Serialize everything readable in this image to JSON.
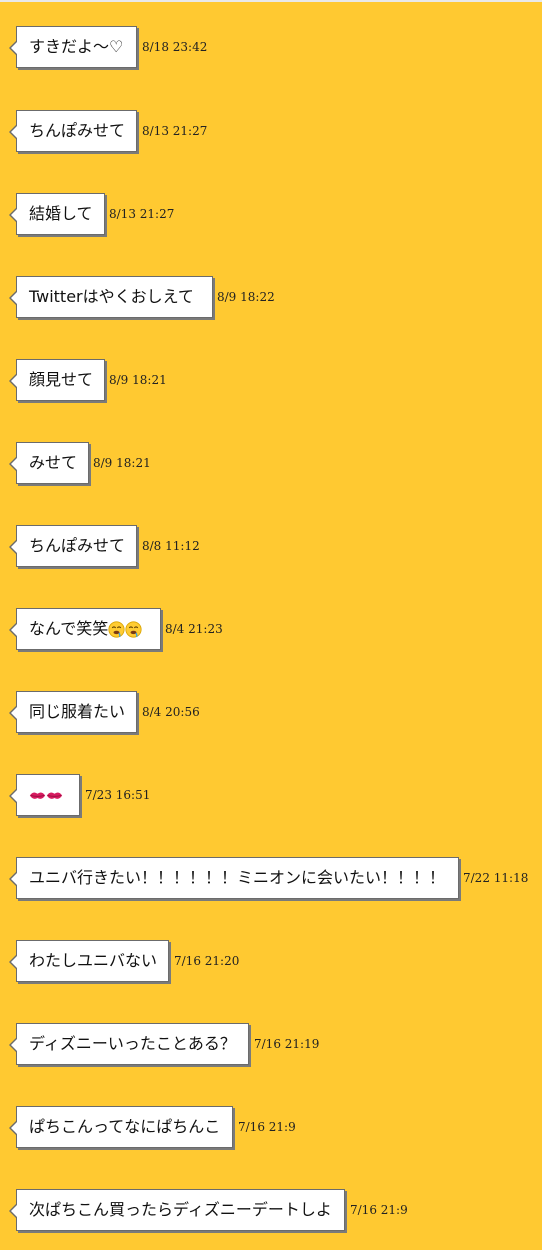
{
  "messages": [
    {
      "text": "すきだよ〜♡",
      "time": "8/18 23:42"
    },
    {
      "text": "ちんぽみせて",
      "time": "8/13 21:27"
    },
    {
      "text": "結婚して",
      "time": "8/13 21:27"
    },
    {
      "text": "Twitterはやくおしえて",
      "time": "8/9 18:22"
    },
    {
      "text": "顔見せて",
      "time": "8/9 18:21"
    },
    {
      "text": "みせて",
      "time": "8/9 18:21"
    },
    {
      "text": "ちんぽみせて",
      "time": "8/8 11:12"
    },
    {
      "text": "なんで笑笑",
      "emoji": "drooling-face-emoji",
      "time": "8/4 21:23"
    },
    {
      "text": "同じ服着たい",
      "time": "8/4 20:56"
    },
    {
      "emoji": "kiss-mark-emoji",
      "time": "7/23 16:51"
    },
    {
      "text": "ユニバ行きたい！！！！！！ミニオンに会いたい！！！！",
      "time": "7/22 11:18"
    },
    {
      "text": "わたしユニバない",
      "time": "7/16 21:20"
    },
    {
      "text": "ディズニーいったことある？",
      "time": "7/16 21:19"
    },
    {
      "text": "ぱちこんってなにぱちんこ",
      "time": "7/16 21:9"
    },
    {
      "text": "次ぱちこん買ったらディズニーデートしよ",
      "time": "7/16 21:9"
    }
  ],
  "colors": {
    "background": "#ffc931",
    "bubble": "#ffffff",
    "bubble_border": "#6b6b6b",
    "text": "#111111"
  }
}
